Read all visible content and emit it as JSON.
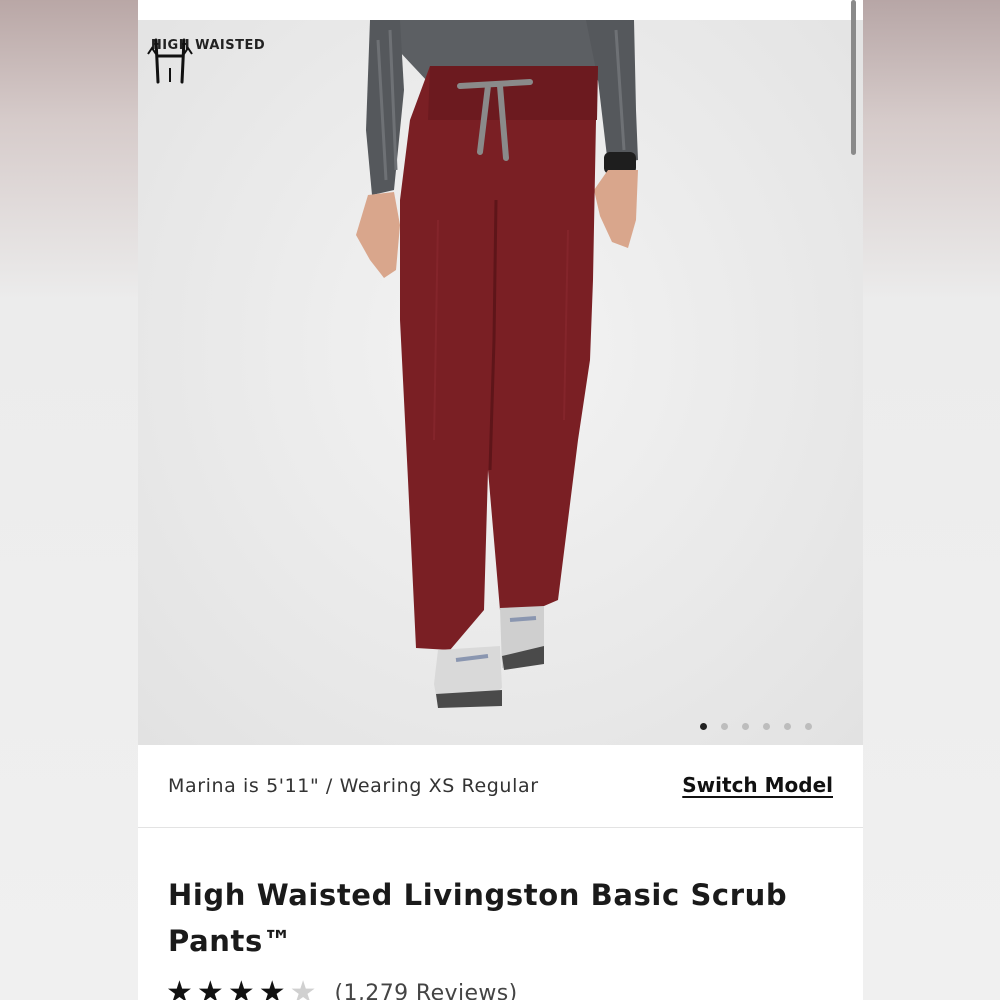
{
  "badge": {
    "label": "HIGH WAISTED",
    "icon": "high-waisted-icon"
  },
  "gallery": {
    "slide_count": 6,
    "active_index": 0
  },
  "model": {
    "info": "Marina is 5'11\" / Wearing XS Regular",
    "switch_label": "Switch Model"
  },
  "product": {
    "title": "High Waisted Livingston Basic Scrub Pants™",
    "rating": 4,
    "rating_max": 5,
    "reviews_label": "(1,279 Reviews)"
  },
  "colors": {
    "pant": "#7a1f24",
    "drawstring": "#8a8a8a",
    "shirt": "#5b5e62",
    "star": "#111111"
  }
}
